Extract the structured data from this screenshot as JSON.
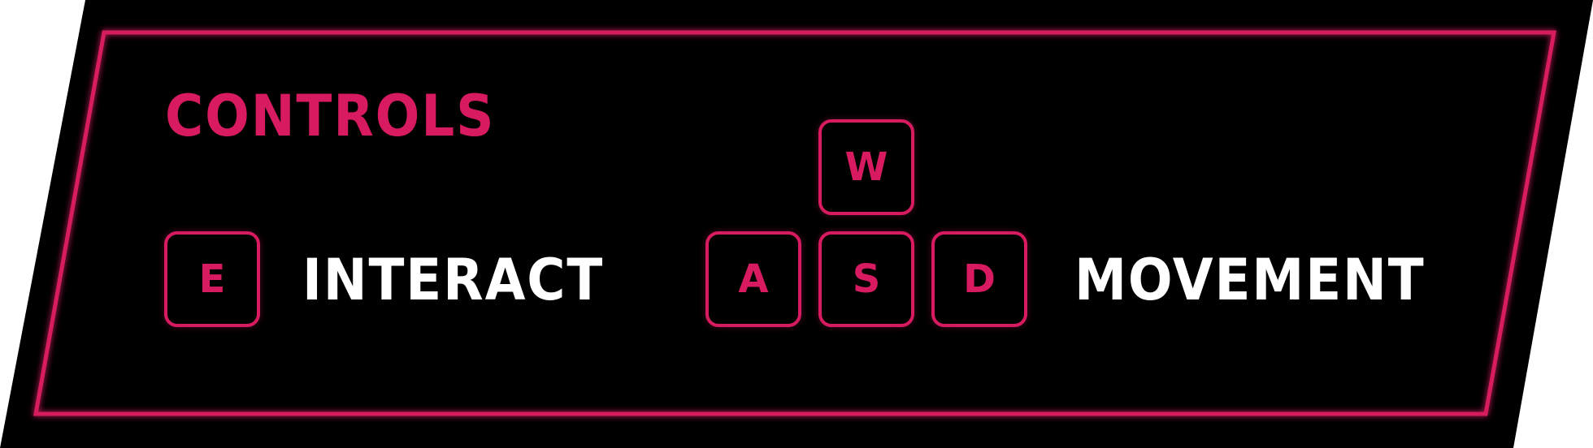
{
  "title": "CONTROLS",
  "bindings": [
    {
      "keys": [
        "E"
      ],
      "action": "INTERACT"
    },
    {
      "keys": [
        "W",
        "A",
        "S",
        "D"
      ],
      "action": "MOVEMENT"
    }
  ],
  "keys": {
    "interact": "E",
    "up": "W",
    "left": "A",
    "down": "S",
    "right": "D"
  },
  "colors": {
    "accent": "#d81b60",
    "background": "#000000",
    "text": "#ffffff"
  }
}
